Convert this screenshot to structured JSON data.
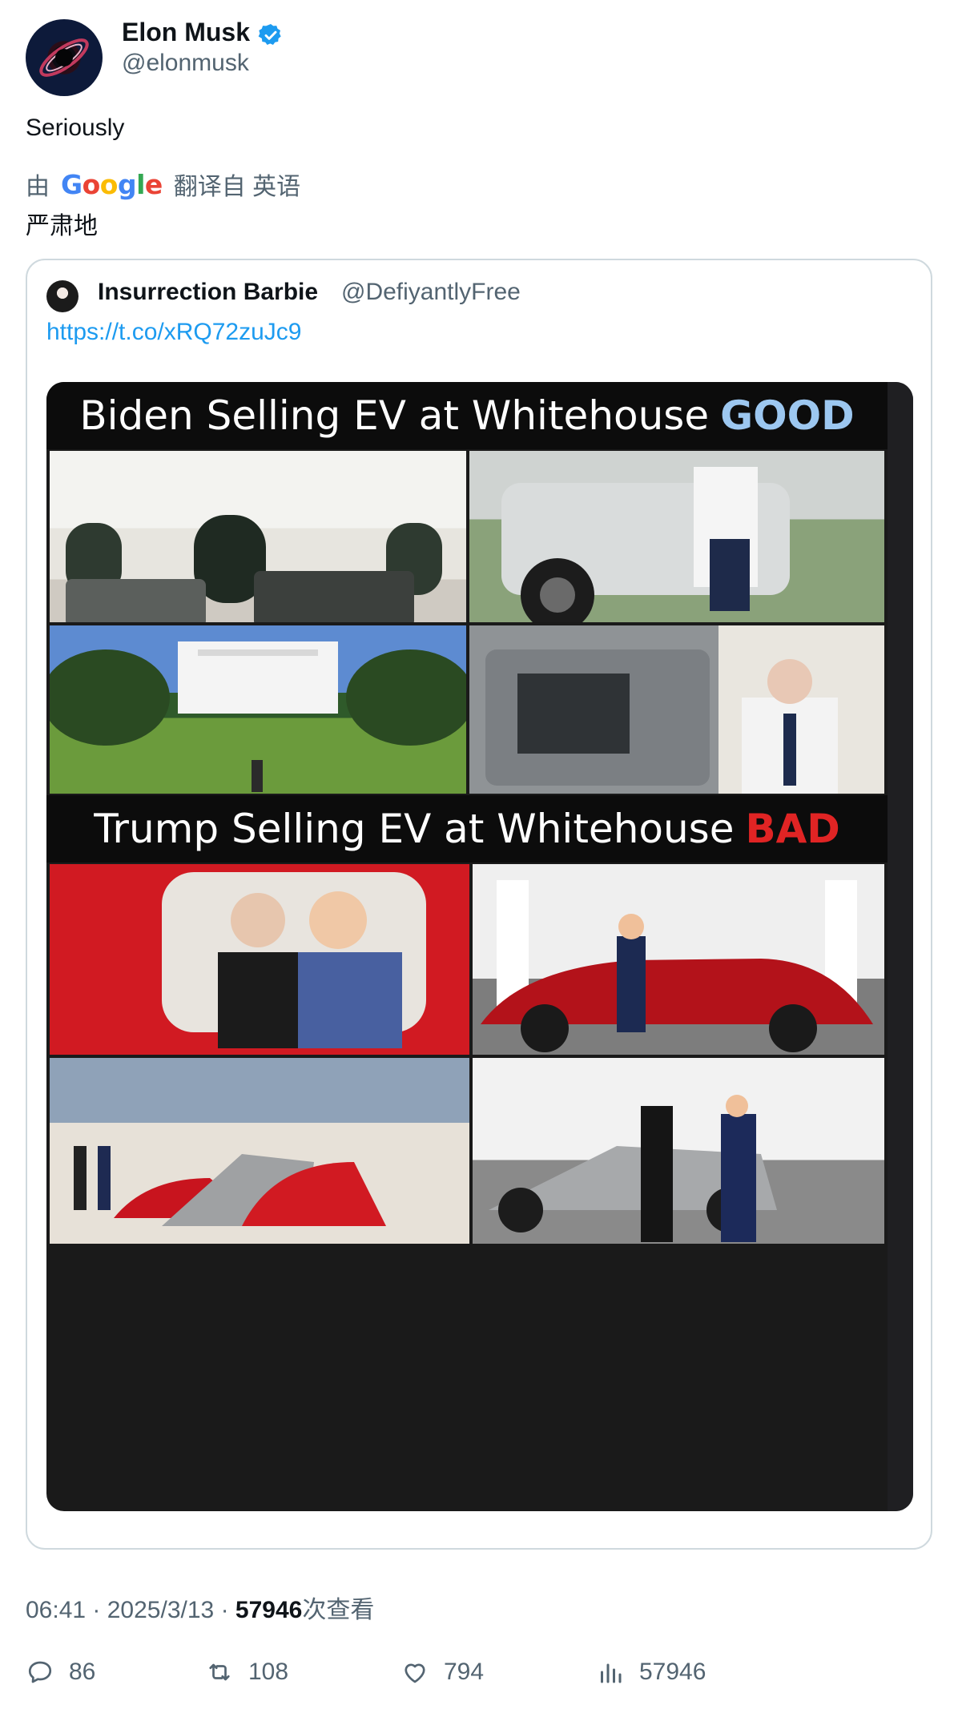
{
  "author": {
    "name": "Elon Musk",
    "handle": "@elonmusk",
    "verified_icon": "verified-badge-icon",
    "accent": "#1d9bf0"
  },
  "tweet": {
    "text": "Seriously",
    "translate_prefix": "由",
    "translate_brand": "Google",
    "translate_suffix": "翻译自 英语",
    "translated_text": "严肃地"
  },
  "quote": {
    "name": "Insurrection Barbie",
    "handle": "@DefiyantlyFree",
    "link": "https://t.co/xRQ72zuJc9",
    "image": {
      "banner_top_text": "Biden Selling EV at Whitehouse",
      "banner_top_highlight": "GOOD",
      "banner_bottom_text": "Trump Selling EV at Whitehouse",
      "banner_bottom_highlight": "BAD",
      "good_color": "#9cc7f0",
      "bad_color": "#e02424"
    }
  },
  "meta": {
    "time": "06:41",
    "date": "2025/3/13",
    "views_count": "57946",
    "views_label": "次查看"
  },
  "actions": {
    "replies": "86",
    "retweets": "108",
    "likes": "794",
    "views": "57946"
  }
}
